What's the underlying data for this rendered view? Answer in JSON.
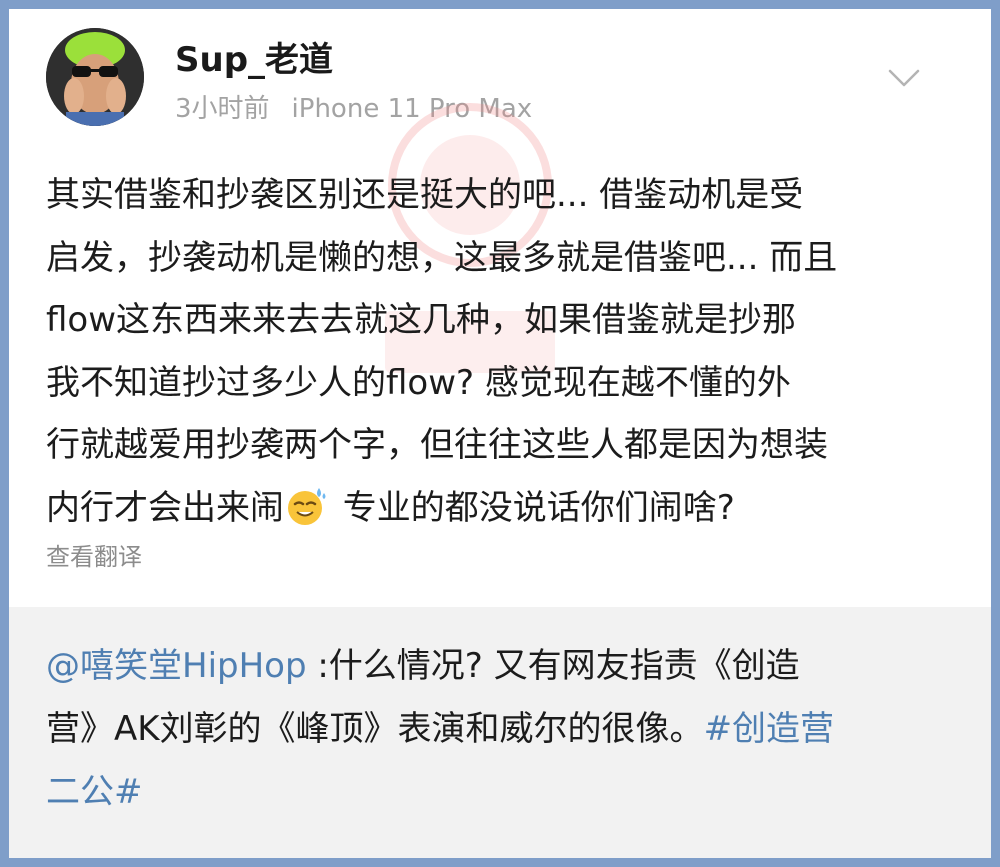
{
  "post": {
    "username": "Sup_老道",
    "time": "3小时前",
    "device": "iPhone 11 Pro Max",
    "body_lines": [
      "其实借鉴和抄袭区别还是挺大的吧... 借鉴动机是受",
      "启发，抄袭动机是懒的想，这最多就是借鉴吧... 而且",
      "flow这东西来来去去就这几种，如果借鉴就是抄那",
      "我不知道抄过多少人的flow? 感觉现在越不懂的外",
      "行就越爱用抄袭两个字，但往往这些人都是因为想装"
    ],
    "body_last_before_emoji": "内行才会出来闹",
    "body_last_after_emoji": " 专业的都没说话你们闹啥?",
    "emoji": "sweat-smile-emoji",
    "translate_label": "查看翻译"
  },
  "repost": {
    "mention": "@嘻笑堂HipHop",
    "line1_text": " :什么情况? 又有网友指责《创造",
    "line2_text": "营》AK刘彰的《峰顶》表演和威尔的很像。",
    "hashtag_part1": "#创造营",
    "hashtag_part2": "二公#"
  },
  "colors": {
    "border": "#7f9ec9",
    "link": "#4f7fb2",
    "meta": "#a3a3a3",
    "repost_bg": "#f2f2f2"
  },
  "icons": {
    "more": "chevron-down-icon"
  }
}
